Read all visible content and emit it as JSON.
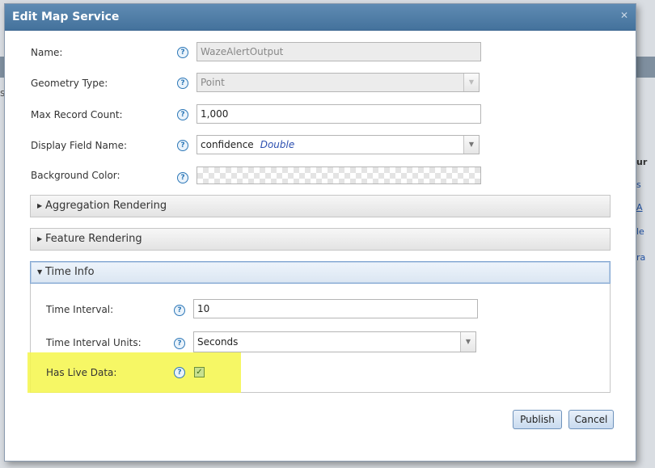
{
  "dialog": {
    "title": "Edit Map Service",
    "close_glyph": "✕"
  },
  "background": {
    "left_fragment": "s",
    "right_fragments": [
      "ur",
      "s",
      "A",
      "le",
      "ra"
    ]
  },
  "form": {
    "name": {
      "label": "Name:",
      "value": "WazeAlertOutput"
    },
    "geometry_type": {
      "label": "Geometry Type:",
      "value": "Point"
    },
    "max_record_count": {
      "label": "Max Record Count:",
      "value": "1,000"
    },
    "display_field_name": {
      "label": "Display Field Name:",
      "value": "confidence",
      "type_hint": "Double"
    },
    "background_color": {
      "label": "Background Color:"
    },
    "help_glyph": "?"
  },
  "sections": {
    "aggregation": {
      "label": "Aggregation Rendering",
      "expanded": false
    },
    "feature": {
      "label": "Feature Rendering",
      "expanded": false
    },
    "time_info": {
      "label": "Time Info",
      "expanded": true
    }
  },
  "time_info": {
    "interval": {
      "label": "Time Interval:",
      "value": "10"
    },
    "interval_units": {
      "label": "Time Interval Units:",
      "value": "Seconds"
    },
    "has_live_data": {
      "label": "Has Live Data:",
      "checked": true,
      "check_glyph": "✓"
    }
  },
  "buttons": {
    "publish": "Publish",
    "cancel": "Cancel"
  },
  "colors": {
    "titlebar": "#4f7ea8",
    "highlight": "#f5f64a",
    "help_icon": "#2c77b7",
    "type_hint": "#2c4fb0"
  }
}
